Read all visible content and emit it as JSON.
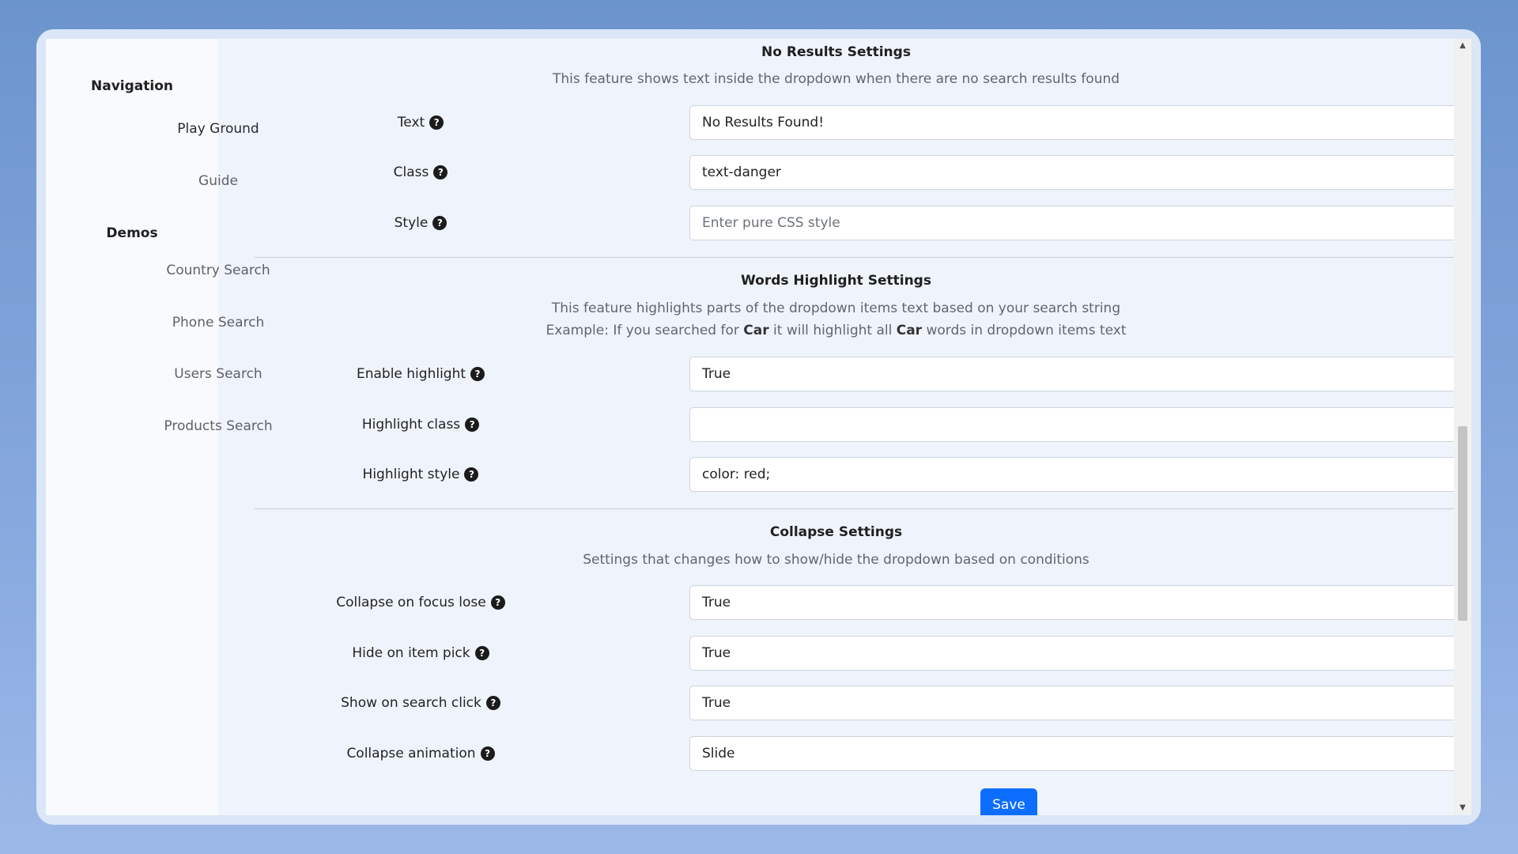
{
  "sidebar": {
    "nav_heading": "Navigation",
    "nav_items": [
      "Play Ground",
      "Guide"
    ],
    "demos_heading": "Demos",
    "demo_items": [
      "Country Search",
      "Phone Search",
      "Users Search",
      "Products Search"
    ]
  },
  "no_results": {
    "title": "No Results Settings",
    "description": "This feature shows text inside the dropdown when there are no search results found",
    "fields": [
      {
        "label": "Text",
        "value": "No Results Found!",
        "placeholder": ""
      },
      {
        "label": "Class",
        "value": "text-danger",
        "placeholder": ""
      },
      {
        "label": "Style",
        "value": "",
        "placeholder": "Enter pure CSS style"
      }
    ]
  },
  "highlight": {
    "title": "Words Highlight Settings",
    "description": "This feature highlights parts of the dropdown items text based on your search string",
    "example_prefix": "Example: If you searched for ",
    "example_word1": "Car",
    "example_middle": " it will highlight all ",
    "example_word2": "Car",
    "example_suffix": " words in dropdown items text",
    "fields": [
      {
        "label": "Enable highlight",
        "value": "True"
      },
      {
        "label": "Highlight class",
        "value": ""
      },
      {
        "label": "Highlight style",
        "value": "color: red;"
      }
    ]
  },
  "collapse": {
    "title": "Collapse Settings",
    "description": "Settings that changes how to show/hide the dropdown based on conditions",
    "fields": [
      {
        "label": "Collapse on focus lose",
        "value": "True"
      },
      {
        "label": "Hide on item pick",
        "value": "True"
      },
      {
        "label": "Show on search click",
        "value": "True"
      },
      {
        "label": "Collapse animation",
        "value": "Slide"
      }
    ]
  },
  "actions": {
    "save_label": "Save"
  },
  "help_glyph": "?",
  "colors": {
    "primary": "#0d6efd",
    "background": "#eff4fc",
    "sidebar": "#f8fafd"
  }
}
